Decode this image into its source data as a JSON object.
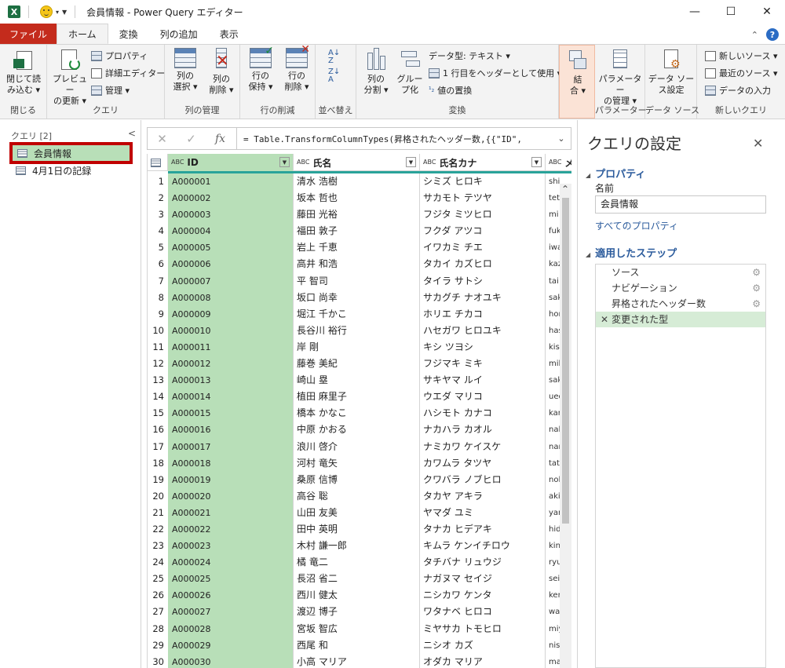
{
  "window": {
    "title": "会員情報 - Power Query エディター",
    "app_icon": "X",
    "min": "—",
    "max": "☐",
    "close": "✕"
  },
  "tabs": [
    {
      "label": "ファイル"
    },
    {
      "label": "ホーム"
    },
    {
      "label": "変換"
    },
    {
      "label": "列の追加"
    },
    {
      "label": "表示"
    }
  ],
  "ribbon": {
    "close_group": {
      "label": "閉じる",
      "close_load_1": "閉じて読",
      "close_load_2": "み込む ▾"
    },
    "query_group": {
      "label": "クエリ",
      "refresh_1": "プレビュー",
      "refresh_2": "の更新 ▾",
      "properties": "プロパティ",
      "advanced_editor": "詳細エディター",
      "manage": "管理 ▾"
    },
    "columns_group": {
      "label": "列の管理",
      "choose_1": "列の",
      "choose_2": "選択 ▾",
      "remove_1": "列の",
      "remove_2": "削除 ▾"
    },
    "rows_group": {
      "label": "行の削減",
      "keep_1": "行の",
      "keep_2": "保持 ▾",
      "remove_1": "行の",
      "remove_2": "削除 ▾"
    },
    "sort_group": {
      "label": "並べ替え"
    },
    "transform_group": {
      "label": "変換",
      "split_1": "列の",
      "split_2": "分割 ▾",
      "group_1": "グルー",
      "group_2": "プ化",
      "datatype": "データ型: テキスト ▾",
      "use_header": "1 行目をヘッダーとして使用 ▾",
      "replace": "値の置換"
    },
    "combine_group": {
      "label": "",
      "combine_1": "結",
      "combine_2": "合 ▾"
    },
    "params_group": {
      "label": "パラメーター",
      "manage_1": "パラメーター",
      "manage_2": "の管理 ▾"
    },
    "datasource_group": {
      "label": "データ ソース",
      "settings_1": "データ ソー",
      "settings_2": "ス設定"
    },
    "newquery_group": {
      "label": "新しいクエリ",
      "new_source": "新しいソース ▾",
      "recent_source": "最近のソース ▾",
      "enter_data": "データの入力"
    }
  },
  "queries": {
    "header": "クエリ [2]",
    "items": [
      {
        "label": "会員情報"
      },
      {
        "label": "4月1日の記録"
      }
    ]
  },
  "formula": {
    "text": "= Table.TransformColumnTypes(昇格されたヘッダー数,{{\"ID\","
  },
  "grid": {
    "columns": [
      {
        "name": "ID",
        "type": "ABC"
      },
      {
        "name": "氏名",
        "type": "ABC"
      },
      {
        "name": "氏名カナ",
        "type": "ABC"
      },
      {
        "name": "メ",
        "type": "ABC"
      }
    ],
    "rows": [
      {
        "n": "1",
        "id": "A000001",
        "name": "清水 浩樹",
        "kana": "シミズ ヒロキ",
        "mail": "shi"
      },
      {
        "n": "2",
        "id": "A000002",
        "name": "坂本 哲也",
        "kana": "サカモト テツヤ",
        "mail": "tet"
      },
      {
        "n": "3",
        "id": "A000003",
        "name": "藤田 光裕",
        "kana": "フジタ ミツヒロ",
        "mail": "mi"
      },
      {
        "n": "4",
        "id": "A000004",
        "name": "福田 敦子",
        "kana": "フクダ アツコ",
        "mail": "fuk"
      },
      {
        "n": "5",
        "id": "A000005",
        "name": "岩上 千恵",
        "kana": "イワカミ チエ",
        "mail": "iwa"
      },
      {
        "n": "6",
        "id": "A000006",
        "name": "高井 和浩",
        "kana": "タカイ カズヒロ",
        "mail": "kaz"
      },
      {
        "n": "7",
        "id": "A000007",
        "name": "平 智司",
        "kana": "タイラ サトシ",
        "mail": "tai"
      },
      {
        "n": "8",
        "id": "A000008",
        "name": "坂口 尚幸",
        "kana": "サカグチ ナオユキ",
        "mail": "sak"
      },
      {
        "n": "9",
        "id": "A000009",
        "name": "堀江 千かこ",
        "kana": "ホリエ チカコ",
        "mail": "hor"
      },
      {
        "n": "10",
        "id": "A000010",
        "name": "長谷川 裕行",
        "kana": "ハセガワ ヒロユキ",
        "mail": "has"
      },
      {
        "n": "11",
        "id": "A000011",
        "name": "岸 剛",
        "kana": "キシ ツヨシ",
        "mail": "kis"
      },
      {
        "n": "12",
        "id": "A000012",
        "name": "藤巻 美紀",
        "kana": "フジマキ ミキ",
        "mail": "mil"
      },
      {
        "n": "13",
        "id": "A000013",
        "name": "崎山 塁",
        "kana": "サキヤマ ルイ",
        "mail": "sak"
      },
      {
        "n": "14",
        "id": "A000014",
        "name": "植田 麻里子",
        "kana": "ウエダ マリコ",
        "mail": "ued"
      },
      {
        "n": "15",
        "id": "A000015",
        "name": "橋本 かなこ",
        "kana": "ハシモト カナコ",
        "mail": "kar"
      },
      {
        "n": "16",
        "id": "A000016",
        "name": "中原 かおる",
        "kana": "ナカハラ カオル",
        "mail": "nal"
      },
      {
        "n": "17",
        "id": "A000017",
        "name": "浪川 啓介",
        "kana": "ナミカワ ケイスケ",
        "mail": "nar"
      },
      {
        "n": "18",
        "id": "A000018",
        "name": "河村 竜矢",
        "kana": "カワムラ タツヤ",
        "mail": "tat"
      },
      {
        "n": "19",
        "id": "A000019",
        "name": "桑原 信博",
        "kana": "クワバラ ノブヒロ",
        "mail": "nol"
      },
      {
        "n": "20",
        "id": "A000020",
        "name": "高谷 聡",
        "kana": "タカヤ アキラ",
        "mail": "aki"
      },
      {
        "n": "21",
        "id": "A000021",
        "name": "山田 友美",
        "kana": "ヤマダ ユミ",
        "mail": "yar"
      },
      {
        "n": "22",
        "id": "A000022",
        "name": "田中 英明",
        "kana": "タナカ ヒデアキ",
        "mail": "hid"
      },
      {
        "n": "23",
        "id": "A000023",
        "name": "木村 謙一郎",
        "kana": "キムラ ケンイチロウ",
        "mail": "kin"
      },
      {
        "n": "24",
        "id": "A000024",
        "name": "橘 竜二",
        "kana": "タチバナ リュウジ",
        "mail": "ryu"
      },
      {
        "n": "25",
        "id": "A000025",
        "name": "長沼 省二",
        "kana": "ナガヌマ セイジ",
        "mail": "sei"
      },
      {
        "n": "26",
        "id": "A000026",
        "name": "西川 健太",
        "kana": "ニシカワ ケンタ",
        "mail": "ker"
      },
      {
        "n": "27",
        "id": "A000027",
        "name": "渡辺 博子",
        "kana": "ワタナベ ヒロコ",
        "mail": "wa"
      },
      {
        "n": "28",
        "id": "A000028",
        "name": "宮坂 智広",
        "kana": "ミヤサカ トモヒロ",
        "mail": "miy"
      },
      {
        "n": "29",
        "id": "A000029",
        "name": "西尾 和",
        "kana": "ニシオ カズ",
        "mail": "nis"
      },
      {
        "n": "30",
        "id": "A000030",
        "name": "小高 マリア",
        "kana": "オダカ マリア",
        "mail": "ma"
      }
    ]
  },
  "settings": {
    "title": "クエリの設定",
    "properties_header": "プロパティ",
    "name_label": "名前",
    "name_value": "会員情報",
    "all_properties": "すべてのプロパティ",
    "steps_header": "適用したステップ",
    "steps": [
      {
        "label": "ソース",
        "gear": true
      },
      {
        "label": "ナビゲーション",
        "gear": true
      },
      {
        "label": "昇格されたヘッダー数",
        "gear": true
      },
      {
        "label": "変更された型",
        "gear": false
      }
    ]
  },
  "colors": {
    "accent_red": "#c42b1c",
    "selected_green": "#b8dfb8",
    "teal_line": "#29a39a",
    "link_blue": "#2b5b9c"
  }
}
